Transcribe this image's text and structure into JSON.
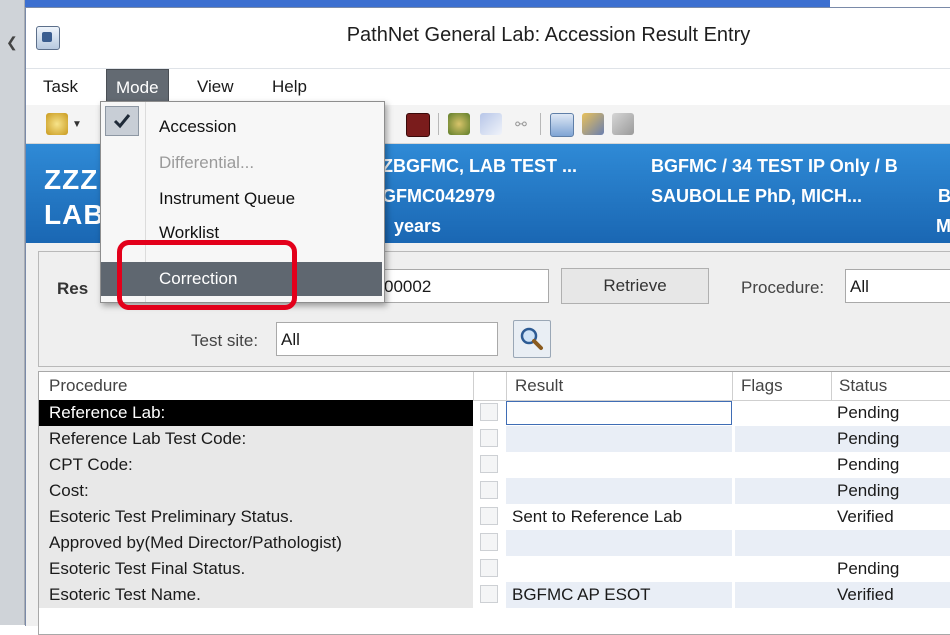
{
  "window": {
    "title": "PathNet General Lab: Accession Result Entry"
  },
  "menubar": {
    "items": [
      "Task",
      "Mode",
      "View",
      "Help"
    ],
    "active": "Mode"
  },
  "mode_menu": {
    "items": [
      {
        "label": "Accession",
        "checked": true,
        "enabled": true
      },
      {
        "label": "Differential...",
        "checked": false,
        "enabled": false
      },
      {
        "label": "Instrument Queue",
        "checked": false,
        "enabled": true
      },
      {
        "label": "Worklist",
        "checked": false,
        "enabled": true
      },
      {
        "label": "Correction",
        "checked": false,
        "enabled": true,
        "highlighted": true
      }
    ]
  },
  "banner": {
    "name_line1": "ZZZ",
    "name_line2": "LAB",
    "patient_name": "ZBGFMC, LAB TEST ...",
    "mrn": "GFMC042979",
    "age": "years",
    "location": "BGFMC / 34 TEST IP Only / B",
    "physician": "SAUBOLLE PhD, MICH...",
    "col3_line2": "B",
    "col3_line3": "M"
  },
  "criteria": {
    "result_label": "Res",
    "accession_value": "00002",
    "retrieve_label": "Retrieve",
    "procedure_label": "Procedure:",
    "procedure_value": "All",
    "test_site_label": "Test site:",
    "test_site_value": "All"
  },
  "grid": {
    "headers": [
      "Procedure",
      "Result",
      "Flags",
      "Status"
    ],
    "rows": [
      {
        "procedure": "Reference Lab:",
        "result": "",
        "flags": "",
        "status": "Pending"
      },
      {
        "procedure": "Reference Lab Test Code:",
        "result": "",
        "flags": "",
        "status": "Pending"
      },
      {
        "procedure": "CPT Code:",
        "result": "",
        "flags": "",
        "status": "Pending"
      },
      {
        "procedure": "Cost:",
        "result": "",
        "flags": "",
        "status": "Pending"
      },
      {
        "procedure": "Esoteric Test Preliminary Status.",
        "result": "Sent to Reference Lab",
        "flags": "",
        "status": "Verified"
      },
      {
        "procedure": "Approved by(Med Director/Pathologist)",
        "result": "",
        "flags": "",
        "status": ""
      },
      {
        "procedure": "Esoteric Test Final Status.",
        "result": "",
        "flags": "",
        "status": "Pending"
      },
      {
        "procedure": "Esoteric Test Name.",
        "result": "BGFMC AP ESOT",
        "flags": "",
        "status": "Verified"
      }
    ]
  },
  "colors": {
    "banner": "#2f8ad6",
    "menu_highlight": "#5f6770",
    "callout": "#e3001b",
    "selected_row": "#000000"
  }
}
